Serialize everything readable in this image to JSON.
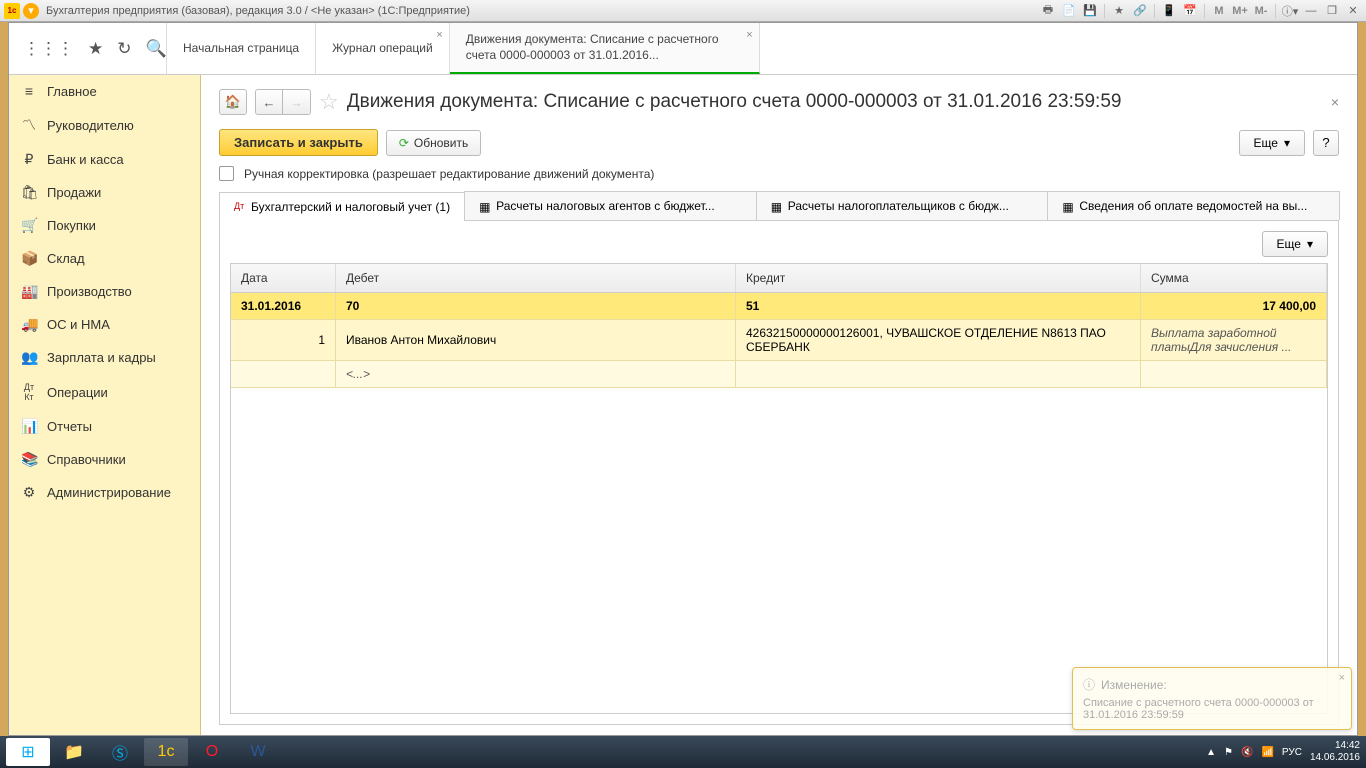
{
  "titlebar": {
    "title": "Бухгалтерия предприятия (базовая), редакция 3.0 / <Не указан>   (1С:Предприятие)",
    "mem": {
      "m": "M",
      "mplus": "M+",
      "mminus": "M-"
    }
  },
  "nav": {
    "tabs": [
      {
        "label": "Начальная страница"
      },
      {
        "label": "Журнал операций"
      },
      {
        "label": "Движения документа: Списание с расчетного счета 0000-000003 от 31.01.2016..."
      }
    ]
  },
  "sidebar": [
    {
      "icon": "≡",
      "label": "Главное"
    },
    {
      "icon": "📈",
      "label": "Руководителю"
    },
    {
      "icon": "₽",
      "label": "Банк и касса"
    },
    {
      "icon": "🛍",
      "label": "Продажи"
    },
    {
      "icon": "🛒",
      "label": "Покупки"
    },
    {
      "icon": "📦",
      "label": "Склад"
    },
    {
      "icon": "🏭",
      "label": "Производство"
    },
    {
      "icon": "🚚",
      "label": "ОС и НМА"
    },
    {
      "icon": "👥",
      "label": "Зарплата и кадры"
    },
    {
      "icon": "ᴬᴷ",
      "label": "Операции"
    },
    {
      "icon": "📊",
      "label": "Отчеты"
    },
    {
      "icon": "📚",
      "label": "Справочники"
    },
    {
      "icon": "⚙",
      "label": "Администрирование"
    }
  ],
  "page": {
    "title": "Движения документа: Списание с расчетного счета 0000-000003 от 31.01.2016 23:59:59",
    "save_close": "Записать и закрыть",
    "refresh": "Обновить",
    "more": "Еще",
    "help": "?",
    "manual_chk": "Ручная корректировка (разрешает редактирование движений документа)"
  },
  "subtabs": [
    {
      "label": "Бухгалтерский и налоговый учет (1)"
    },
    {
      "label": "Расчеты налоговых агентов с бюджет..."
    },
    {
      "label": "Расчеты налогоплательщиков с бюдж..."
    },
    {
      "label": "Сведения об оплате ведомостей на вы..."
    }
  ],
  "table": {
    "headers": {
      "date": "Дата",
      "debit": "Дебет",
      "credit": "Кредит",
      "sum": "Сумма"
    },
    "rows": [
      {
        "date": "31.01.2016",
        "debit": "70",
        "credit": "51",
        "sum": "17 400,00"
      },
      {
        "date": "1",
        "debit": "Иванов Антон Михайлович",
        "credit": "42632150000000126001, ЧУВАШСКОЕ ОТДЕЛЕНИЕ N8613 ПАО СБЕРБАНК",
        "sum": "Выплата заработной платыДля зачисления ..."
      },
      {
        "date": "",
        "debit": "<...>",
        "credit": "",
        "sum": ""
      }
    ]
  },
  "notification": {
    "title": "Изменение:",
    "body": "Списание с расчетного счета 0000-000003 от 31.01.2016 23:59:59"
  },
  "taskbar": {
    "time": "14:42",
    "date": "14.06.2016",
    "lang": "РУС"
  }
}
